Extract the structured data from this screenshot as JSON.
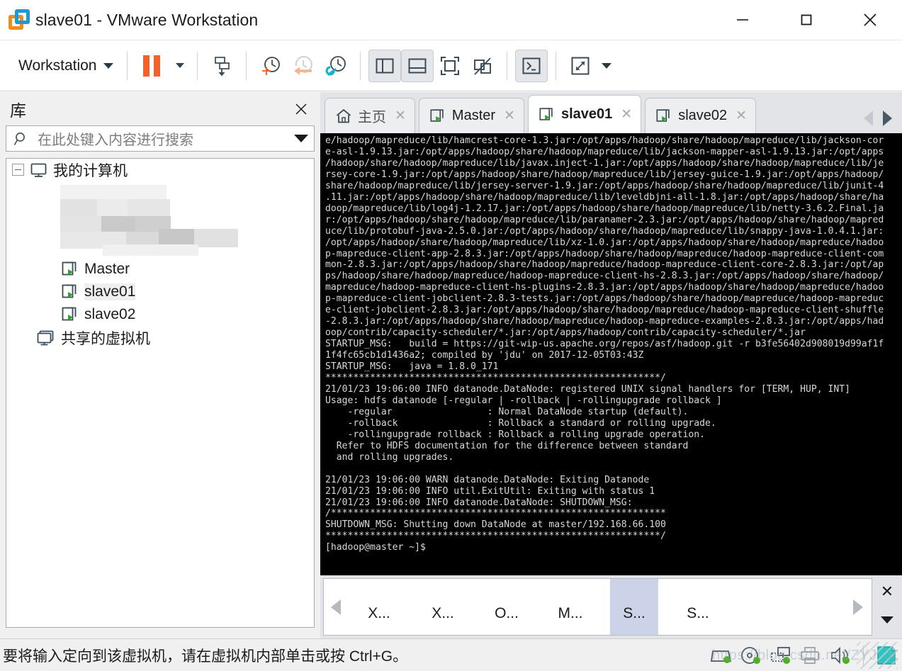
{
  "window": {
    "title": "slave01 - VMware Workstation",
    "logo_icon": "vmware-logo-icon",
    "minimize_label": "—",
    "maximize_label": "□",
    "close_label": "✕"
  },
  "toolbar": {
    "menu_label": "Workstation",
    "buttons": [
      {
        "name": "pause-vm-button",
        "icon": "pause-icon"
      },
      {
        "name": "pause-dropdown-button",
        "icon": "chevron-down-icon"
      },
      {
        "name": "send-ctrl-alt-del-button",
        "icon": "snapshot-manager-icon"
      },
      {
        "name": "take-snapshot-button",
        "icon": "clock-plus-icon"
      },
      {
        "name": "revert-snapshot-button",
        "icon": "clock-back-arrow-icon"
      },
      {
        "name": "manage-snapshots-button",
        "icon": "clock-wrench-icon"
      },
      {
        "name": "show-library-button",
        "icon": "panel-left-icon"
      },
      {
        "name": "show-thumbnail-bar-button",
        "icon": "panel-bottom-icon"
      },
      {
        "name": "enter-fullscreen-button",
        "icon": "fullscreen-icon"
      },
      {
        "name": "unity-mode-button",
        "icon": "unity-disabled-icon"
      },
      {
        "name": "console-view-button",
        "icon": "terminal-icon"
      },
      {
        "name": "stretch-guest-button",
        "icon": "stretch-arrows-icon"
      },
      {
        "name": "stretch-dropdown-button",
        "icon": "chevron-down-icon"
      }
    ]
  },
  "sidebar": {
    "title": "库",
    "close_icon": "close-icon",
    "search": {
      "icon": "search-icon",
      "placeholder": "在此处键入内容进行搜索",
      "value": "",
      "dropdown_icon": "chevron-down-icon"
    },
    "tree": {
      "root": {
        "label": "我的计算机",
        "icon": "monitor-icon",
        "expander": "collapse-minus-icon"
      },
      "items": [
        {
          "label": "Master",
          "icon": "vm-running-icon",
          "selected": false
        },
        {
          "label": "slave01",
          "icon": "vm-running-icon",
          "selected": true
        },
        {
          "label": "slave02",
          "icon": "vm-running-icon",
          "selected": false
        }
      ],
      "shared": {
        "label": "共享的虚拟机",
        "icon": "shared-vms-icon"
      }
    }
  },
  "tabs": {
    "items": [
      {
        "label": "主页",
        "icon": "home-icon",
        "active": false,
        "dim": true,
        "close_icon": "close-icon"
      },
      {
        "label": "Master",
        "icon": "vm-running-icon",
        "active": false,
        "dim": false,
        "close_icon": "close-icon"
      },
      {
        "label": "slave01",
        "icon": "vm-running-icon",
        "active": true,
        "dim": false,
        "close_icon": "close-icon"
      },
      {
        "label": "slave02",
        "icon": "vm-running-icon",
        "active": false,
        "dim": false,
        "close_icon": "close-icon"
      }
    ],
    "nav_prev_icon": "triangle-left-icon",
    "nav_next_icon": "triangle-right-icon"
  },
  "terminal": {
    "background": "#000000",
    "foreground": "#d8d8d8",
    "text": "e/hadoop/mapreduce/lib/hamcrest-core-1.3.jar:/opt/apps/hadoop/share/hadoop/mapreduce/lib/jackson-cor\ne-asl-1.9.13.jar:/opt/apps/hadoop/share/hadoop/mapreduce/lib/jackson-mapper-asl-1.9.13.jar:/opt/apps\n/hadoop/share/hadoop/mapreduce/lib/javax.inject-1.jar:/opt/apps/hadoop/share/hadoop/mapreduce/lib/je\nrsey-core-1.9.jar:/opt/apps/hadoop/share/hadoop/mapreduce/lib/jersey-guice-1.9.jar:/opt/apps/hadoop/\nshare/hadoop/mapreduce/lib/jersey-server-1.9.jar:/opt/apps/hadoop/share/hadoop/mapreduce/lib/junit-4\n.11.jar:/opt/apps/hadoop/share/hadoop/mapreduce/lib/leveldbjni-all-1.8.jar:/opt/apps/hadoop/share/ha\ndoop/mapreduce/lib/log4j-1.2.17.jar:/opt/apps/hadoop/share/hadoop/mapreduce/lib/netty-3.6.2.Final.ja\nr:/opt/apps/hadoop/share/hadoop/mapreduce/lib/paranamer-2.3.jar:/opt/apps/hadoop/share/hadoop/mapred\nuce/lib/protobuf-java-2.5.0.jar:/opt/apps/hadoop/share/hadoop/mapreduce/lib/snappy-java-1.0.4.1.jar:\n/opt/apps/hadoop/share/hadoop/mapreduce/lib/xz-1.0.jar:/opt/apps/hadoop/share/hadoop/mapreduce/hadoo\np-mapreduce-client-app-2.8.3.jar:/opt/apps/hadoop/share/hadoop/mapreduce/hadoop-mapreduce-client-com\nmon-2.8.3.jar:/opt/apps/hadoop/share/hadoop/mapreduce/hadoop-mapreduce-client-core-2.8.3.jar:/opt/ap\nps/hadoop/share/hadoop/mapreduce/hadoop-mapreduce-client-hs-2.8.3.jar:/opt/apps/hadoop/share/hadoop/\nmapreduce/hadoop-mapreduce-client-hs-plugins-2.8.3.jar:/opt/apps/hadoop/share/hadoop/mapreduce/hadoo\np-mapreduce-client-jobclient-2.8.3-tests.jar:/opt/apps/hadoop/share/hadoop/mapreduce/hadoop-mapreduc\ne-client-jobclient-2.8.3.jar:/opt/apps/hadoop/share/hadoop/mapreduce/hadoop-mapreduce-client-shuffle\n-2.8.3.jar:/opt/apps/hadoop/share/hadoop/mapreduce/hadoop-mapreduce-examples-2.8.3.jar:/opt/apps/had\noop/contrib/capacity-scheduler/*.jar:/opt/apps/hadoop/contrib/capacity-scheduler/*.jar\nSTARTUP_MSG:   build = https://git-wip-us.apache.org/repos/asf/hadoop.git -r b3fe56402d908019d99af1f\n1f4fc65cb1d1436a2; compiled by 'jdu' on 2017-12-05T03:43Z\nSTARTUP_MSG:   java = 1.8.0_171\n************************************************************/\n21/01/23 19:06:00 INFO datanode.DataNode: registered UNIX signal handlers for [TERM, HUP, INT]\nUsage: hdfs datanode [-regular | -rollback | -rollingupgrade rollback ]\n    -regular                 : Normal DataNode startup (default).\n    -rollback                : Rollback a standard or rolling upgrade.\n    -rollingupgrade rollback : Rollback a rolling upgrade operation.\n  Refer to HDFS documentation for the difference between standard\n  and rolling upgrades.\n\n21/01/23 19:06:00 WARN datanode.DataNode: Exiting Datanode\n21/01/23 19:06:00 INFO util.ExitUtil: Exiting with status 1\n21/01/23 19:06:00 INFO datanode.DataNode: SHUTDOWN_MSG:\n/************************************************************\nSHUTDOWN_MSG: Shutting down DataNode at master/192.168.66.100\n************************************************************/\n[hadoop@master ~]$"
  },
  "thumbnail_bar": {
    "prev_icon": "triangle-left-icon",
    "next_icon": "triangle-right-icon",
    "items": [
      {
        "label": "X...",
        "selected": false
      },
      {
        "label": "X...",
        "selected": false
      },
      {
        "label": "O...",
        "selected": false
      },
      {
        "label": "M...",
        "selected": false
      },
      {
        "label": "S...",
        "selected": true
      },
      {
        "label": "S...",
        "selected": false
      }
    ],
    "close_label": "✕",
    "dropdown_icon": "chevron-down-icon"
  },
  "statusbar": {
    "message": "要将输入定向到该虚拟机，请在虚拟机内部单击或按 Ctrl+G。",
    "icons": [
      {
        "name": "hard-disk-status-icon",
        "active_color": "#4caf26"
      },
      {
        "name": "cd-dvd-status-icon",
        "active_color": "#4caf26"
      },
      {
        "name": "network-adapter-status-icon",
        "active_color": "#4caf26"
      },
      {
        "name": "printer-status-icon",
        "active_color": "#9aa2a8"
      },
      {
        "name": "sound-card-status-icon",
        "active_color": "#4caf26"
      },
      {
        "name": "shared-folders-status-icon",
        "active_color": "#2ec4c0"
      }
    ],
    "watermark": "https://blog.csdn.net/ZYJ_JOvOv"
  },
  "colors": {
    "accent_orange": "#f2622a",
    "accent_blue": "#1a9ad7",
    "toolbar_icon": "#3b4b57",
    "selection_blue": "#ccd2e8",
    "chrome_gray": "#e2e4e7"
  }
}
